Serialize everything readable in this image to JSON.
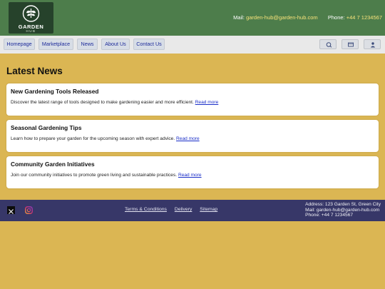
{
  "header": {
    "logo": {
      "word": "GARDEN",
      "sub": "HUB"
    },
    "mail_label": "Mail:",
    "mail_value": "garden-hub@garden-hub.com",
    "phone_label": "Phone:",
    "phone_value": "+44 7 1234567"
  },
  "nav": {
    "items": [
      "Homepage",
      "Marketplace",
      "News",
      "About Us",
      "Contact Us"
    ],
    "icons": [
      "search-icon",
      "cart-icon",
      "user-icon"
    ]
  },
  "main": {
    "title": "Latest News",
    "articles": [
      {
        "title": "New Gardening Tools Released",
        "text": "Discover the latest range of tools designed to make gardening easier and more efficient.",
        "link": "Read more"
      },
      {
        "title": "Seasonal Gardening Tips",
        "text": "Learn how to prepare your garden for the upcoming season with expert advice.",
        "link": "Read more"
      },
      {
        "title": "Community Garden Initiatives",
        "text": "Join our community initiatives to promote green living and sustainable practices.",
        "link": "Read more"
      }
    ]
  },
  "footer": {
    "links": [
      "Terms & Conditions",
      "Delivery",
      "Sitemap"
    ],
    "address": "Address: 123 Garden St, Green City",
    "mail": "Mail: garden-hub@garden-hub.com",
    "phone": "Phone: +44 7 1234567",
    "social": [
      "x-icon",
      "instagram-icon"
    ]
  },
  "colors": {
    "header_bg": "#4d7d4b",
    "page_bg": "#dbb653",
    "footer_bg": "#373768",
    "link": "#1a2ec8"
  }
}
